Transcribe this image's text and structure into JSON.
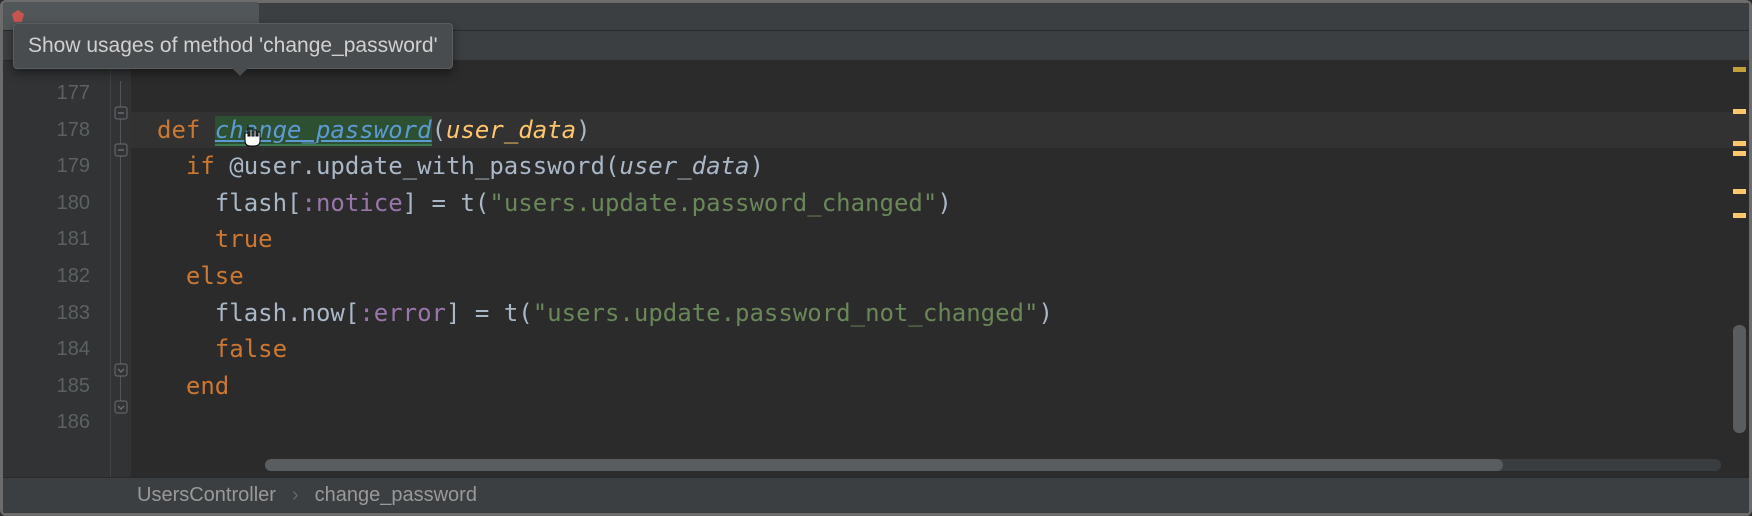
{
  "tooltip": {
    "text": "Show usages of method 'change_password'"
  },
  "tab": {
    "title": "",
    "icon": "ruby-file-icon"
  },
  "gutter": {
    "start": 177,
    "lines": [
      "177",
      "178",
      "179",
      "180",
      "181",
      "182",
      "183",
      "184",
      "185",
      "186"
    ]
  },
  "code": {
    "line177": "",
    "line178": {
      "kw": "def",
      "name": "change_password",
      "paren_open": "(",
      "param": "user_data",
      "paren_close": ")"
    },
    "line179": {
      "kw": "if",
      "ivar": "@user",
      "dot": ".",
      "method": "update_with_password",
      "paren_open": "(",
      "param": "user_data",
      "paren_close": ")"
    },
    "line180": {
      "flash": "flash",
      "br_open": "[",
      "sym": ":notice",
      "br_close": "]",
      "eq": " = ",
      "t": "t",
      "paren_open": "(",
      "str": "\"users.update.password_changed\"",
      "paren_close": ")"
    },
    "line181": {
      "kw": "true"
    },
    "line182": {
      "kw": "else"
    },
    "line183": {
      "flash": "flash",
      "dot": ".",
      "now": "now",
      "br_open": "[",
      "sym": ":error",
      "br_close": "]",
      "eq": " = ",
      "t": "t",
      "paren_open": "(",
      "str": "\"users.update.password_not_changed\"",
      "paren_close": ")"
    },
    "line184": {
      "kw": "false"
    },
    "line185": {
      "kw": "end"
    },
    "line186": ""
  },
  "breadcrumb": {
    "item1": "UsersController",
    "sep": "›",
    "item2": "change_password"
  }
}
